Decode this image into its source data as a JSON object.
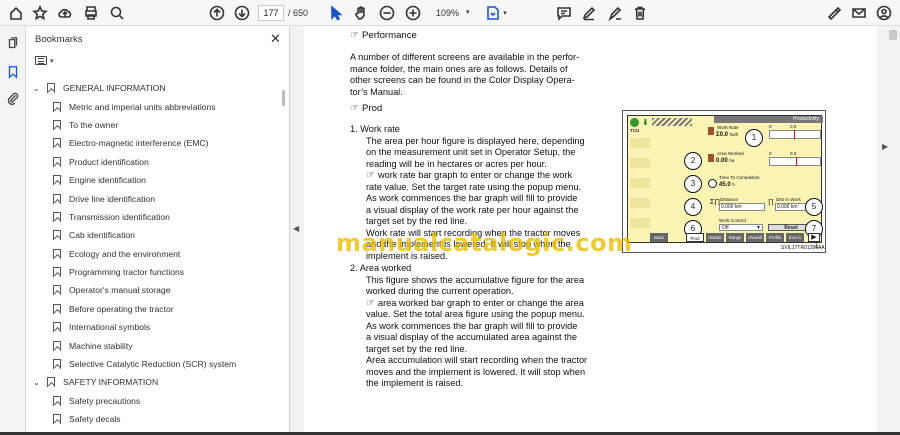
{
  "toolbar": {
    "current_page": "177",
    "page_count": "/ 650",
    "zoom": "109%"
  },
  "bookmarks": {
    "title": "Bookmarks",
    "items": [
      {
        "label": "GENERAL INFORMATION",
        "level": 0
      },
      {
        "label": "Metric and imperial units abbreviations",
        "level": 1
      },
      {
        "label": "To the owner",
        "level": 1
      },
      {
        "label": "Electro-magnetic interference (EMC)",
        "level": 1
      },
      {
        "label": "Product identification",
        "level": 1
      },
      {
        "label": "Engine identification",
        "level": 1
      },
      {
        "label": "Drive line identification",
        "level": 1
      },
      {
        "label": "Transmission identification",
        "level": 1
      },
      {
        "label": "Cab identification",
        "level": 1
      },
      {
        "label": "Ecology and the environment",
        "level": 1
      },
      {
        "label": "Programming tractor functions",
        "level": 1
      },
      {
        "label": "Operator's manual storage",
        "level": 1
      },
      {
        "label": "Before operating the tractor",
        "level": 1
      },
      {
        "label": "International symbols",
        "level": 1
      },
      {
        "label": "Machine stability",
        "level": 1
      },
      {
        "label": "Selective Catalytic Reduction (SCR) system",
        "level": 1
      },
      {
        "label": "SAFETY INFORMATION",
        "level": 0
      },
      {
        "label": "Safety precautions",
        "level": 1
      },
      {
        "label": "Safety decals",
        "level": 1
      }
    ]
  },
  "document": {
    "performance_heading": "Performance",
    "intro_lines": [
      "A number of different screens are available in the perfor-",
      "mance folder, the main ones are as follows.  Details of",
      "other screens can be found in the Color Display Opera-",
      "tor’s Manual."
    ],
    "prod_heading": "Prod",
    "item1_title": "1.   Work rate",
    "item1_lines": [
      "The area per hour figure is displayed here, depending",
      "on the measurement unit set in Operator Setup, the",
      "reading will be in hectares or acres per hour.",
      "work rate bar graph to enter or change the work",
      "rate value. Set the target rate using the popup menu.",
      "As work commences the bar graph will fill to provide",
      "a visual display of the work rate per hour against the",
      "target set by the red line.",
      "Work rate will start recording when the tractor moves",
      "and the implement is lowered.  It will stop when the",
      "implement is raised."
    ],
    "item2_title": "2.   Area worked",
    "item2_lines": [
      "This figure shows the accumulative figure for the area",
      "worked during the current operation.",
      "area worked bar graph to enter or change the area",
      "value. Set the total area figure using the popup menu.",
      "As work commences the bar graph will fill to provide",
      "a visual display of the accumulated area against the",
      "target set by the red line.",
      "Area accumulation will start recording when the tractor",
      "moves and the implement is lowered.  It will stop when",
      "the implement is raised."
    ],
    "watermark": "manualcatalogic.com"
  },
  "figure": {
    "screen_title": "Productivity",
    "work_rate_label": "Work Rate",
    "work_rate_value": "0.0",
    "work_rate_unit": "ha/h",
    "area_worked_label": "Area Worked",
    "area_worked_value": "0.00",
    "area_worked_unit": "ha",
    "time_label": "Time To Completion",
    "time_value": "45.0",
    "time_unit": "h",
    "distance_label": "Distance",
    "distance_value": "0.000",
    "distance_unit": "km",
    "dist_in_work_label": "Dist In Work",
    "dist_in_work_value": "0.000",
    "dist_in_work_unit": "km",
    "work_control_label": "Work Control",
    "work_control_value": "Off",
    "reset_label": "Reset",
    "scale_labels": [
      "0",
      "0.0",
      "0",
      "0.0"
    ],
    "callouts": [
      "1",
      "2",
      "3",
      "4",
      "5",
      "6",
      "7"
    ],
    "soft_buttons": [
      "Back",
      "Prod",
      "Instant",
      "Range",
      "Overall",
      "Profile",
      "Eco+1"
    ],
    "caption": "SVIL17TR01286AA",
    "fig_number": "1"
  }
}
